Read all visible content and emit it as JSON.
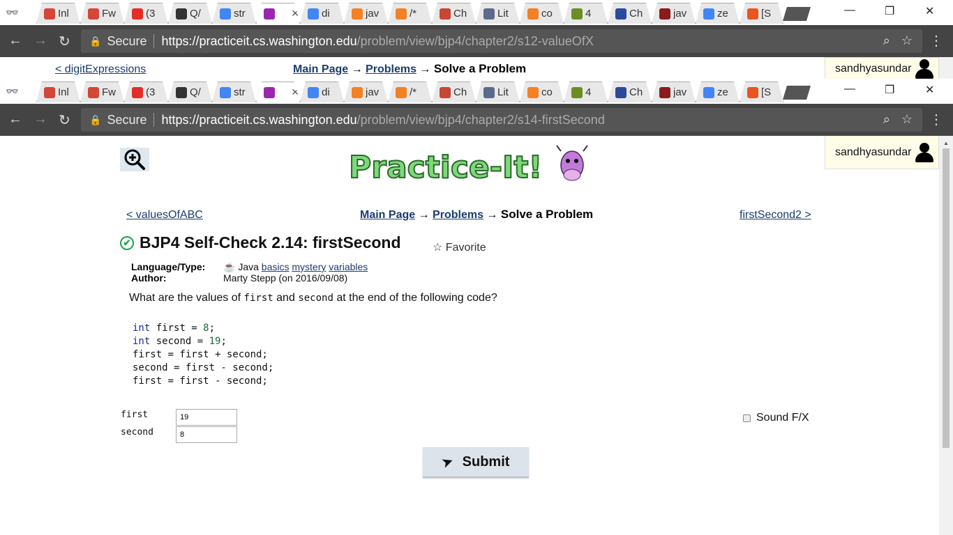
{
  "back_window": {
    "url_domain": "https://practiceit.cs.washington.edu",
    "url_path": "/problem/view/bjp4/chapter2/s12-valueOfX",
    "prev_link": "< digitExpressions",
    "main_page": "Main Page",
    "problems": "Problems",
    "current": "Solve a Problem",
    "user": "sandhyasundar"
  },
  "tabs": [
    {
      "label": "Inl",
      "color": "#d44638",
      "icon": "gmail-icon"
    },
    {
      "label": "Fw",
      "color": "#d44638",
      "icon": "gmail-icon"
    },
    {
      "label": "(3",
      "color": "#e52d27",
      "icon": "youtube-icon"
    },
    {
      "label": "Q/",
      "color": "#333333",
      "icon": "github-icon"
    },
    {
      "label": "str",
      "color": "#4285f4",
      "icon": "google-icon"
    },
    {
      "label": "",
      "color": "#9b27b0",
      "icon": "practiceit-icon",
      "active": true
    },
    {
      "label": "di",
      "color": "#4285f4",
      "icon": "google-icon"
    },
    {
      "label": "jav",
      "color": "#f48024",
      "icon": "stackoverflow-icon"
    },
    {
      "label": "/*",
      "color": "#f48024",
      "icon": "stackoverflow-icon"
    },
    {
      "label": "Ch",
      "color": "#c74634",
      "icon": "oracle-icon"
    },
    {
      "label": "Lit",
      "color": "#5a6b8c",
      "icon": "doc-icon"
    },
    {
      "label": "co",
      "color": "#f48024",
      "icon": "stackoverflow-icon"
    },
    {
      "label": "4",
      "color": "#6b8e23",
      "icon": "wh-icon"
    },
    {
      "label": "Ch",
      "color": "#2c4a9c",
      "icon": "star-shield-icon"
    },
    {
      "label": "jav",
      "color": "#8b1a1a",
      "icon": "crest-icon"
    },
    {
      "label": "ze",
      "color": "#4285f4",
      "icon": "google-icon"
    },
    {
      "label": "[S",
      "color": "#e95420",
      "icon": "ubuntu-icon"
    }
  ],
  "address": {
    "secure_label": "Secure",
    "url_domain": "https://practiceit.cs.washington.edu",
    "url_path": "/problem/view/bjp4/chapter2/s14-firstSecond"
  },
  "user": {
    "name": "sandhyasundar"
  },
  "nav": {
    "prev": "< valuesOfABC",
    "main_page": "Main Page",
    "arrow": "→",
    "problems": "Problems",
    "current": "Solve a Problem",
    "next": "firstSecond2 >"
  },
  "problem": {
    "title": "BJP4 Self-Check 2.14: firstSecond",
    "favorite": "Favorite",
    "lang_key": "Language/Type:",
    "lang_val": "Java",
    "tags": [
      "basics",
      "mystery",
      "variables"
    ],
    "author_key": "Author:",
    "author_val": "Marty Stepp (on 2016/09/08)",
    "q_pre": "What are the values of",
    "q_var1": "first",
    "q_and": "and",
    "q_var2": "second",
    "q_post": "at the end of the following code?"
  },
  "code": {
    "l1_kw": "int",
    "l1_rest": " first = ",
    "l1_num": "8",
    "l1_end": ";",
    "l2_kw": "int",
    "l2_rest": " second = ",
    "l2_num": "19",
    "l2_end": ";",
    "l3": "first = first + second;",
    "l4": "second = first - second;",
    "l5": "first = first - second;"
  },
  "answers": {
    "first_label": "first",
    "first_value": "19",
    "second_label": "second",
    "second_value": "8"
  },
  "sound": "Sound F/X",
  "submit": "Submit"
}
